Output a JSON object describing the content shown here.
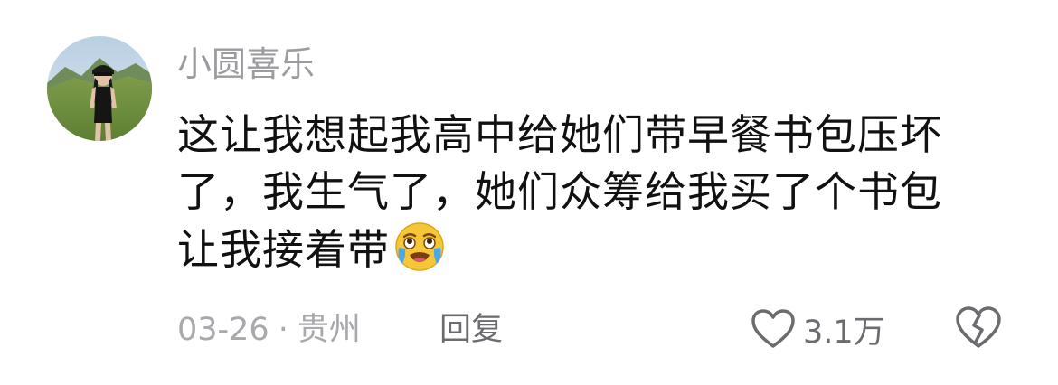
{
  "comment": {
    "username": "小圆喜乐",
    "content_lines": [
      "这让我想起我高中给她们带早餐书包压坏",
      "了，我生气了，她们众筹给我买了个书包",
      "让我接着带"
    ],
    "emoji": "crying-laughing-emoji",
    "date": "03-26",
    "separator": "·",
    "location": "贵州",
    "reply_label": "回复",
    "like_count": "3.1万"
  },
  "icons": {
    "like": "heart-outline-icon",
    "dislike": "broken-heart-icon"
  },
  "colors": {
    "username": "#9b9ba0",
    "text": "#111111",
    "meta": "#a8a8ad",
    "action": "#6b6b70"
  }
}
